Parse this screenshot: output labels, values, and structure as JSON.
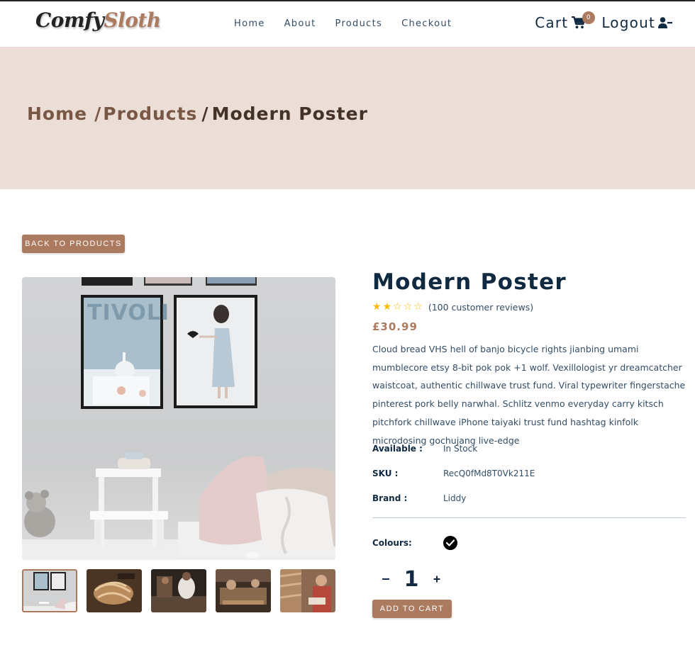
{
  "nav": {
    "logo_left": "Comfy",
    "logo_right": "Sloth",
    "links": [
      "Home",
      "About",
      "Products",
      "Checkout"
    ],
    "cart_label": "Cart",
    "cart_count": "0",
    "logout_label": "Logout"
  },
  "hero": {
    "crumb_home": "Home",
    "crumb_products": "Products",
    "crumb_current": "Modern Poster"
  },
  "back_button": "BACK TO PRODUCTS",
  "product": {
    "title": "Modern Poster",
    "rating": 2,
    "rating_max": 5,
    "reviews": "(100 customer reviews)",
    "price": "£30.99",
    "description": "Cloud bread VHS hell of banjo bicycle rights jianbing umami mumblecore etsy 8-bit pok pok +1 wolf. Vexillologist yr dreamcatcher waistcoat, authentic chillwave trust fund. Viral typewriter fingerstache pinterest pork belly narwhal. Schlitz venmo everyday carry kitsch pitchfork chillwave iPhone taiyaki trust fund hashtag kinfolk microdosing gochujang live-edge",
    "available_label": "Available :",
    "available_value": "In Stock",
    "sku_label": "SKU :",
    "sku_value": "RecQ0fMd8T0Vk211E",
    "brand_label": "Brand :",
    "brand_value": "Liddy",
    "colours_label": "Colours:",
    "colour_swatch": "#000000",
    "quantity": "1",
    "add_to_cart": "ADD TO CART"
  },
  "poster_text": "TIVOLI",
  "colors": {
    "accent": "#ab7a5f",
    "hero_bg": "#eaded7",
    "heading": "#102a42",
    "star": "#ffb900"
  }
}
